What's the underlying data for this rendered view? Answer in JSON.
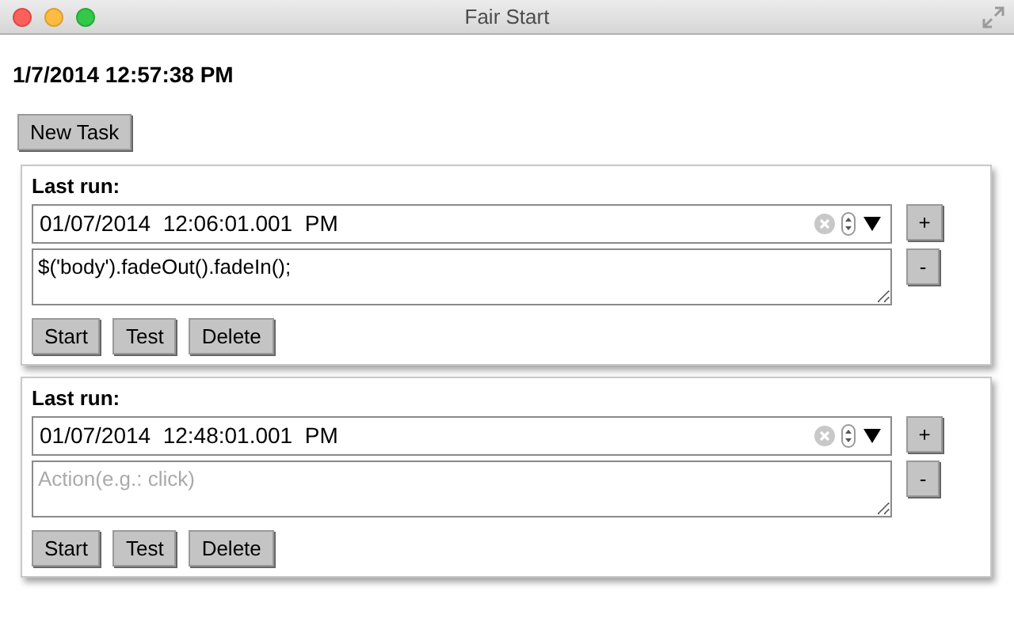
{
  "window": {
    "title": "Fair Start"
  },
  "clock": "1/7/2014 12:57:38 PM",
  "new_task_button": "New Task",
  "tasks": [
    {
      "label": "Last run:",
      "datetime": "01/07/2014  12:06:01.001  PM",
      "action": {
        "value": "$('body').fadeOut().fadeIn();"
      },
      "add_button": "+",
      "remove_button": "-",
      "buttons": [
        "Start",
        "Test",
        "Delete"
      ]
    },
    {
      "label": "Last run:",
      "datetime": "01/07/2014  12:48:01.001  PM",
      "action": {
        "placeholder": "Action(e.g.: click)"
      },
      "add_button": "+",
      "remove_button": "-",
      "buttons": [
        "Start",
        "Test",
        "Delete"
      ]
    }
  ]
}
